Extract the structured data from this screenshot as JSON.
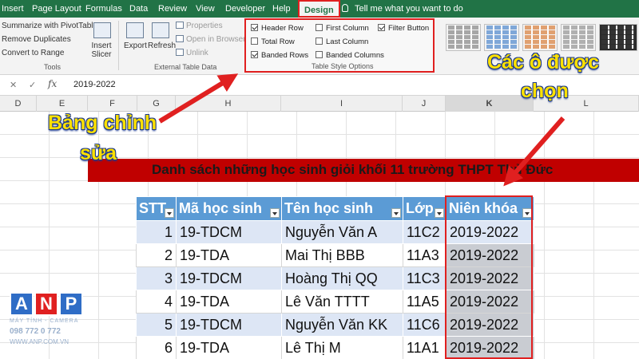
{
  "ribbon_tabs": [
    "Insert",
    "Page Layout",
    "Formulas",
    "Data",
    "Review",
    "View",
    "Developer",
    "Help",
    "Design"
  ],
  "active_tab": "Design",
  "tell_me": "Tell me what you want to do",
  "tools": {
    "items": [
      "Summarize with PivotTable",
      "Remove Duplicates",
      "Convert to Range"
    ],
    "label": "Tools",
    "insert_slicer": "Insert Slicer"
  },
  "external": {
    "export": "Export",
    "refresh": "Refresh",
    "properties": "Properties",
    "open_in_browser": "Open in Browser",
    "unlink": "Unlink",
    "label": "External Table Data"
  },
  "style_options": {
    "header_row": {
      "label": "Header Row",
      "checked": true
    },
    "total_row": {
      "label": "Total Row",
      "checked": false
    },
    "banded_rows": {
      "label": "Banded Rows",
      "checked": true
    },
    "first_column": {
      "label": "First Column",
      "checked": false
    },
    "last_column": {
      "label": "Last Column",
      "checked": false
    },
    "banded_columns": {
      "label": "Banded Columns",
      "checked": false
    },
    "filter_button": {
      "label": "Filter Button",
      "checked": true
    },
    "label": "Table Style Options"
  },
  "formula_bar": {
    "value": "2019-2022"
  },
  "columns": [
    "D",
    "E",
    "F",
    "G",
    "H",
    "I",
    "J",
    "K",
    "L"
  ],
  "sheet_title": "Danh sách những học sinh giỏi khối 11 trường THPT Thủ Đức",
  "table": {
    "headers": [
      "STT",
      "Mã học sinh",
      "Tên học sinh",
      "Lớp",
      "Niên khóa"
    ],
    "rows": [
      [
        "1",
        "19-TDCM",
        "Nguyễn Văn A",
        "11C2",
        "2019-2022"
      ],
      [
        "2",
        "19-TDA",
        "Mai Thị BBB",
        "11A3",
        "2019-2022"
      ],
      [
        "3",
        "19-TDCM",
        "Hoàng Thị QQ",
        "11C3",
        "2019-2022"
      ],
      [
        "4",
        "19-TDA",
        "Lê Văn TTTT",
        "11A5",
        "2019-2022"
      ],
      [
        "5",
        "19-TDCM",
        "Nguyễn Văn KK",
        "11C6",
        "2019-2022"
      ],
      [
        "6",
        "19-TDA",
        "Lê Thị M",
        "11A1",
        "2019-2022"
      ]
    ]
  },
  "annotations": {
    "edit_table_line1": "Bảng chỉnh",
    "edit_table_line2": "sửa",
    "selected_line1": "Các ô được",
    "selected_line2": "chọn"
  },
  "logo": {
    "letters": [
      "A",
      "N",
      "P"
    ],
    "tagline": "MÁY TÍNH - CAMERA",
    "phone": "098 772 0 772",
    "website": "WWW.ANP.COM.VN"
  },
  "colors": {
    "ribbon_green": "#217346",
    "table_header": "#5b9bd5",
    "band_row": "#dde6f5",
    "title_band": "#c00000",
    "highlight_red": "#e02020",
    "annotation_yellow": "#ffe100"
  }
}
